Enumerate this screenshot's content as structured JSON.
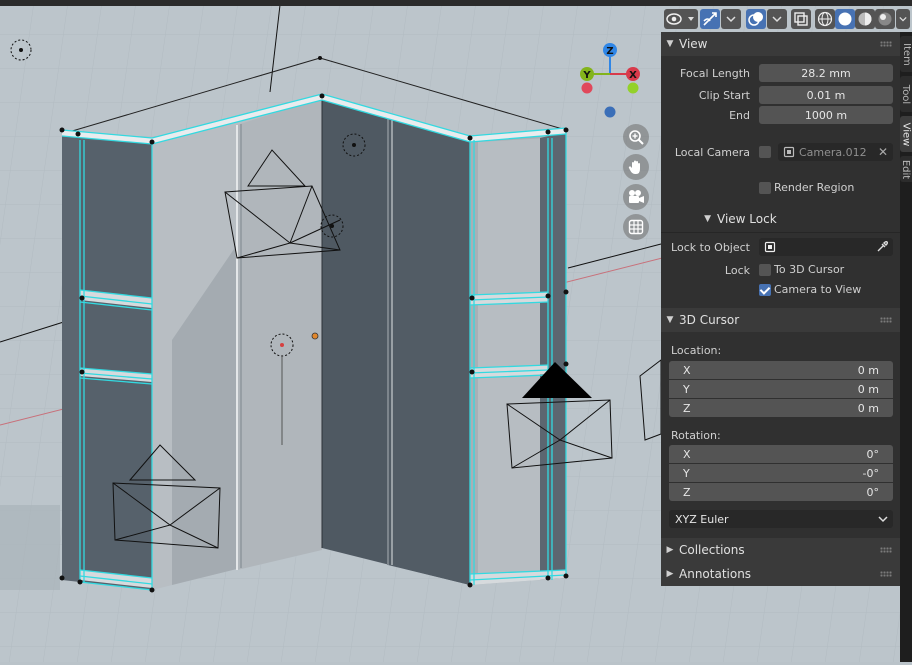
{
  "header": {
    "icons": [
      "view-object-types-icon",
      "gizmo-icon",
      "overlays-icon",
      "xray-icon",
      "wireframe-shading-icon",
      "solid-shading-icon",
      "material-preview-icon",
      "rendered-shading-icon"
    ]
  },
  "tabs": [
    "Item",
    "Tool",
    "View",
    "Edit"
  ],
  "view_panel": {
    "title": "View",
    "focal_length_label": "Focal Length",
    "focal_length": "28.2 mm",
    "clip_start_label": "Clip Start",
    "clip_start": "0.01 m",
    "end_label": "End",
    "end": "1000 m",
    "local_camera_label": "Local Camera",
    "local_camera_value": "Camera.012",
    "render_region_label": "Render Region"
  },
  "view_lock": {
    "title": "View Lock",
    "lock_to_object_label": "Lock to Object",
    "lock_label": "Lock",
    "to_3d_cursor_label": "To 3D Cursor",
    "camera_to_view_label": "Camera to View",
    "camera_to_view_checked": true
  },
  "cursor_panel": {
    "title": "3D Cursor",
    "location_label": "Location:",
    "location": [
      {
        "axis": "X",
        "value": "0 m"
      },
      {
        "axis": "Y",
        "value": "0 m"
      },
      {
        "axis": "Z",
        "value": "0 m"
      }
    ],
    "rotation_label": "Rotation:",
    "rotation": [
      {
        "axis": "X",
        "value": "0°"
      },
      {
        "axis": "Y",
        "value": "-0°"
      },
      {
        "axis": "Z",
        "value": "0°"
      }
    ],
    "rotation_mode": "XYZ Euler"
  },
  "collections_title": "Collections",
  "annotations_title": "Annotations",
  "gizmo": {
    "x": "X",
    "y": "Y",
    "z": "Z"
  },
  "colors": {
    "accent": "#4772b3",
    "selection": "#33d9e0",
    "x_axis": "#d83a4b",
    "y_axis": "#83b41b",
    "z_axis": "#2f86e6"
  }
}
